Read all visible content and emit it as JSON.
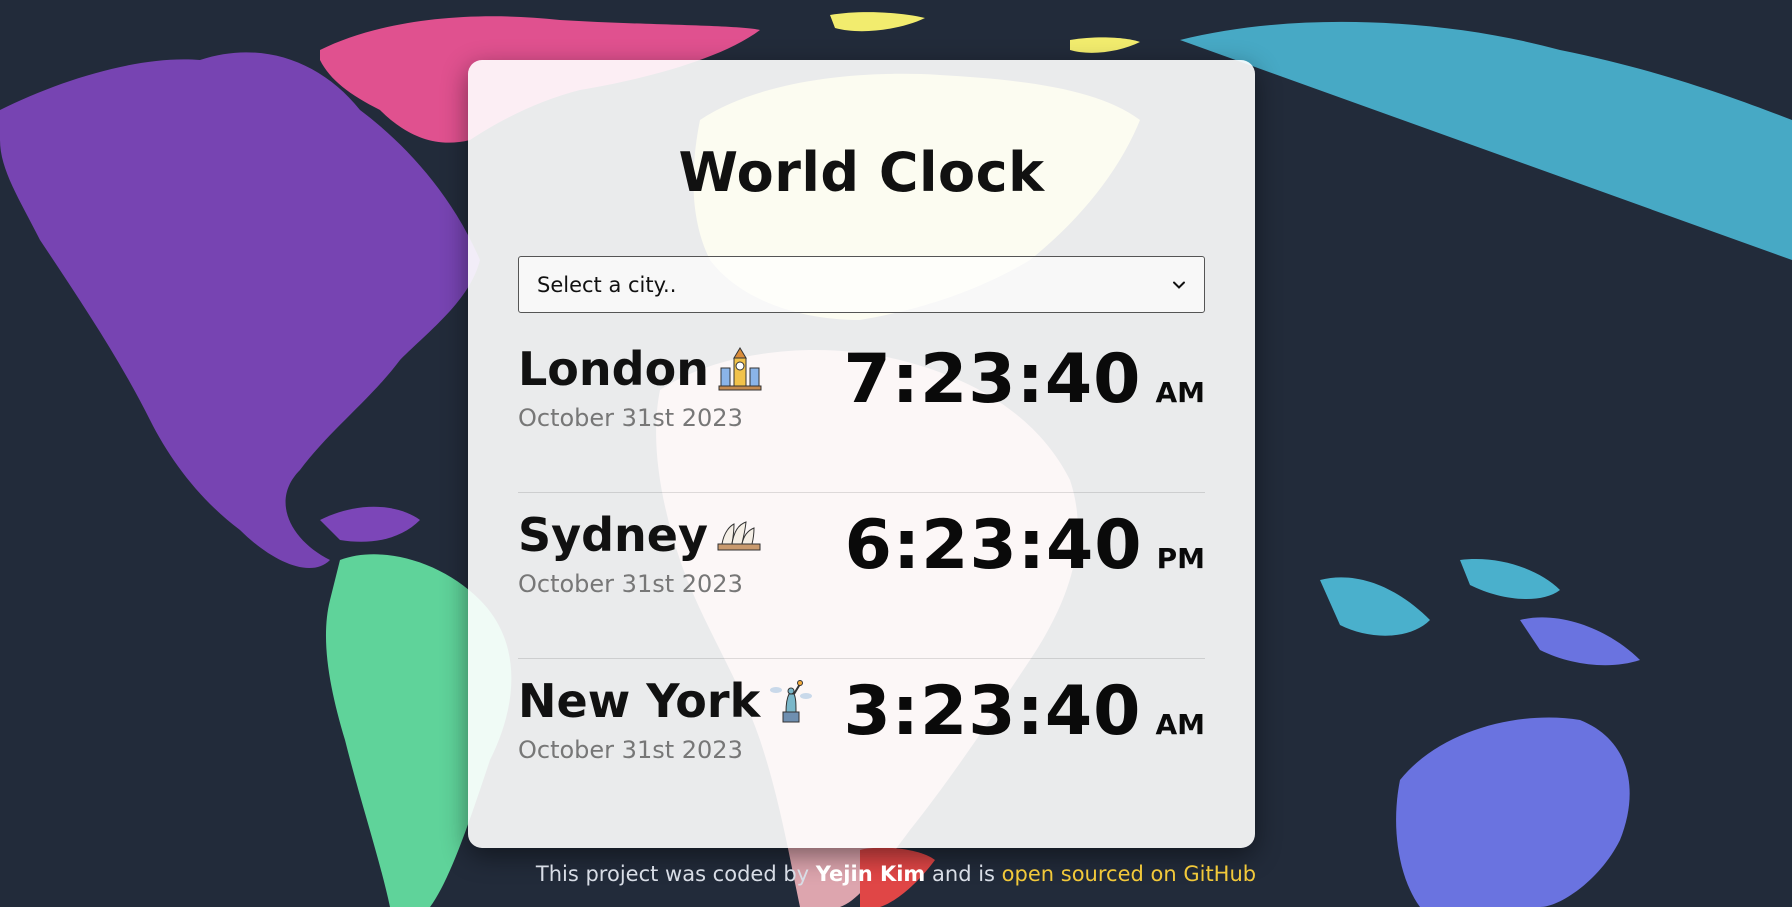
{
  "app": {
    "title": "World Clock"
  },
  "select": {
    "placeholder": "Select a city.."
  },
  "cities": [
    {
      "name": "London",
      "date": "October 31st 2023",
      "time": "7:23:40",
      "ampm": "AM"
    },
    {
      "name": "Sydney",
      "date": "October 31st 2023",
      "time": "6:23:40",
      "ampm": "PM"
    },
    {
      "name": "New York",
      "date": "October 31st 2023",
      "time": "3:23:40",
      "ampm": "AM"
    }
  ],
  "footer": {
    "prefix": "This project was coded by",
    "author": "Yejin Kim",
    "middle": "and is",
    "link_text": "open sourced on GitHub"
  },
  "colors": {
    "background": "#222b3a",
    "north_america": "#7c46b8",
    "greenland": "#e0518f",
    "south_america": "#5fd39a",
    "europe": "#f2ec6e",
    "africa": "#f2b3bb",
    "asia": "#4ab0cc",
    "australia": "#6a73e0",
    "link": "#f2c93a"
  },
  "icons": {
    "select": "chevron-down-icon",
    "london": "big-ben-icon",
    "sydney": "opera-house-icon",
    "new_york": "statue-of-liberty-icon"
  }
}
